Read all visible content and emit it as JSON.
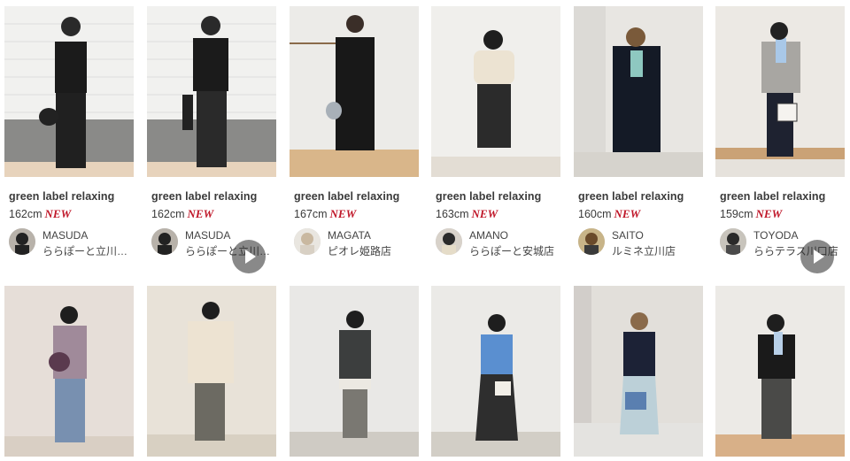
{
  "colors": {
    "new_badge": "#c0182a",
    "text": "#3a3a3a",
    "play_overlay": "rgba(40,40,40,0.55)"
  },
  "row1": [
    {
      "brand": "green label relaxing",
      "height": "162cm",
      "badge": "NEW",
      "staff_name": "MASUDA",
      "shop": "ららぽーと立川立飛店",
      "has_video": true
    },
    {
      "brand": "green label relaxing",
      "height": "162cm",
      "badge": "NEW",
      "staff_name": "MASUDA",
      "shop": "ららぽーと立川立飛店",
      "has_video": true
    },
    {
      "brand": "green label relaxing",
      "height": "167cm",
      "badge": "NEW",
      "staff_name": "MAGATA",
      "shop": "ピオレ姫路店",
      "has_video": false
    },
    {
      "brand": "green label relaxing",
      "height": "163cm",
      "badge": "NEW",
      "staff_name": "AMANO",
      "shop": "ららぽーと安城店",
      "has_video": true
    },
    {
      "brand": "green label relaxing",
      "height": "160cm",
      "badge": "NEW",
      "staff_name": "SAITO",
      "shop": "ルミネ立川店",
      "has_video": false
    },
    {
      "brand": "green label relaxing",
      "height": "159cm",
      "badge": "NEW",
      "staff_name": "TOYODA",
      "shop": "ららテラス川口店",
      "has_video": false
    }
  ],
  "row2_video": [
    false,
    true,
    false,
    false,
    false,
    true
  ],
  "icons": {
    "play": "play-icon"
  }
}
